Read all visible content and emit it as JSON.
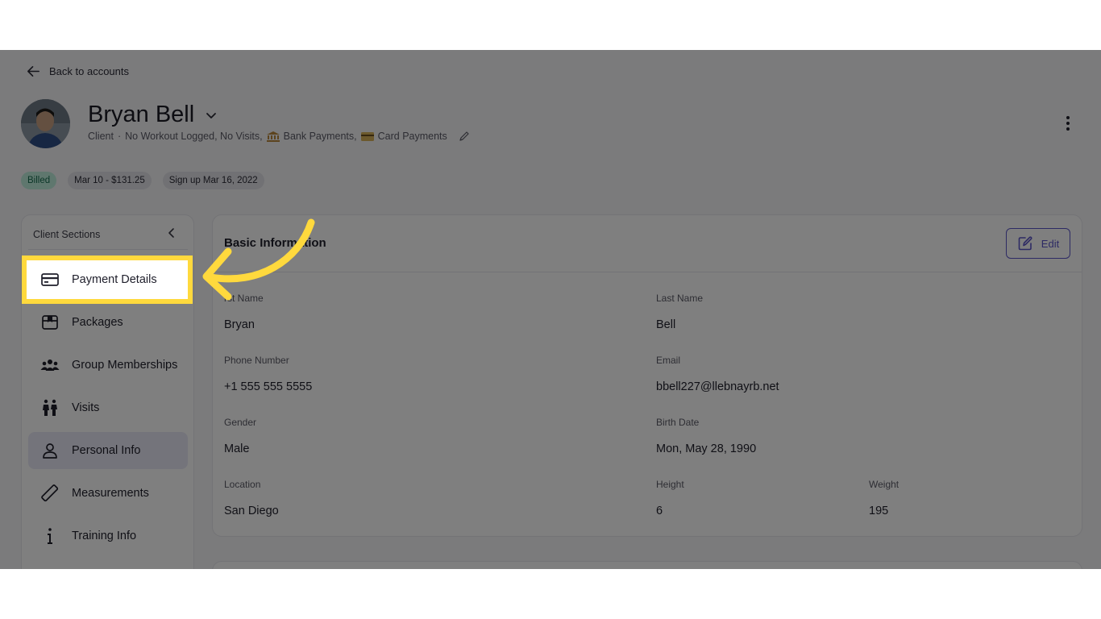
{
  "nav": {
    "back_label": "Back to accounts"
  },
  "client": {
    "name": "Bryan Bell",
    "role": "Client",
    "separator": "·",
    "status_text": "No Workout Logged, No Visits,",
    "bank_label": "Bank Payments,",
    "card_label": "Card Payments",
    "chips": {
      "billed": "Billed",
      "last_charge": "Mar 10 - $131.25",
      "signup": "Sign up Mar 16, 2022"
    }
  },
  "sidebar": {
    "title": "Client Sections",
    "items": [
      {
        "label": "Payment Details",
        "icon": "credit-card-icon"
      },
      {
        "label": "Packages",
        "icon": "package-icon"
      },
      {
        "label": "Group Memberships",
        "icon": "group-icon"
      },
      {
        "label": "Visits",
        "icon": "visits-icon"
      },
      {
        "label": "Personal Info",
        "icon": "person-icon"
      },
      {
        "label": "Measurements",
        "icon": "ruler-icon"
      },
      {
        "label": "Training Info",
        "icon": "info-icon"
      }
    ],
    "active_item": "Personal Info",
    "highlighted_item": "Payment Details"
  },
  "basic_info": {
    "title": "Basic Information",
    "edit_label": "Edit",
    "first_name_label": "rst Name",
    "first_name": "Bryan",
    "last_name_label": "Last Name",
    "last_name": "Bell",
    "phone_label": "Phone Number",
    "phone": "+1 555 555 5555",
    "email_label": "Email",
    "email": "bbell227@llebnayrb.net",
    "gender_label": "Gender",
    "gender": "Male",
    "birth_label": "Birth Date",
    "birth_date": "Mon, May 28, 1990",
    "location_label": "Location",
    "location": "San Diego",
    "height_label": "Height",
    "height": "6",
    "weight_label": "Weight",
    "weight": "195"
  },
  "colors": {
    "accent": "#5b55c8",
    "highlight": "#ffd93d",
    "billed_bg": "#bfeedd",
    "billed_text": "#166d4f",
    "active_item_bg": "#e9e9f6"
  }
}
